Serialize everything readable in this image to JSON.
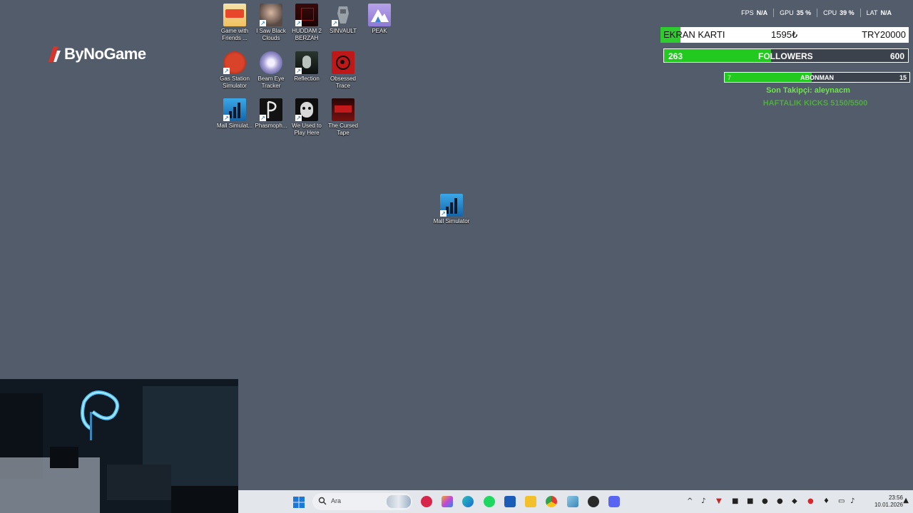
{
  "logo": {
    "text": "ByNoGame"
  },
  "desktop_icons": [
    {
      "label": "Game with Friends ..."
    },
    {
      "label": "I Saw Black Clouds"
    },
    {
      "label": "HUDDAM 2 BERZAH"
    },
    {
      "label": "SINVAULT"
    },
    {
      "label": "PEAK"
    },
    {
      "label": "Gas Station Simulator"
    },
    {
      "label": "Beam Eye Tracker"
    },
    {
      "label": "Reflection"
    },
    {
      "label": "Obsessed Trace"
    },
    {
      "label": "Mall Simulat..."
    },
    {
      "label": "Phasmoph..."
    },
    {
      "label": "We Used to Play Here"
    },
    {
      "label": "The Cursed Tape"
    },
    {
      "label": "Mall Simulator"
    }
  ],
  "stats": {
    "fps_label": "FPS",
    "fps_value": "N/A",
    "gpu_label": "GPU",
    "gpu_value": "35 %",
    "cpu_label": "CPU",
    "cpu_value": "39 %",
    "lat_label": "LAT",
    "lat_value": "N/A"
  },
  "ekran": {
    "title": "EKRAN KARTI",
    "current": "1595₺",
    "goal": "TRY20000",
    "progress": 0.08
  },
  "followers": {
    "current": "263",
    "label": "FOLLOWERS",
    "goal": "600",
    "progress": 0.44
  },
  "abone": {
    "current": "7",
    "label": "ABONMAN",
    "goal": "15",
    "progress": 0.47
  },
  "son_takipci": "Son Takipçi: aleynacm",
  "haftalik": "HAFTALIK KICKS 5150/5500",
  "taskbar": {
    "search_placeholder": "Ara",
    "time": "23:56",
    "date": "10.01.2026"
  },
  "colors": {
    "desktop": "#535c6a",
    "accent_green": "#22c91e",
    "taskbar": "#e3e6ea"
  }
}
